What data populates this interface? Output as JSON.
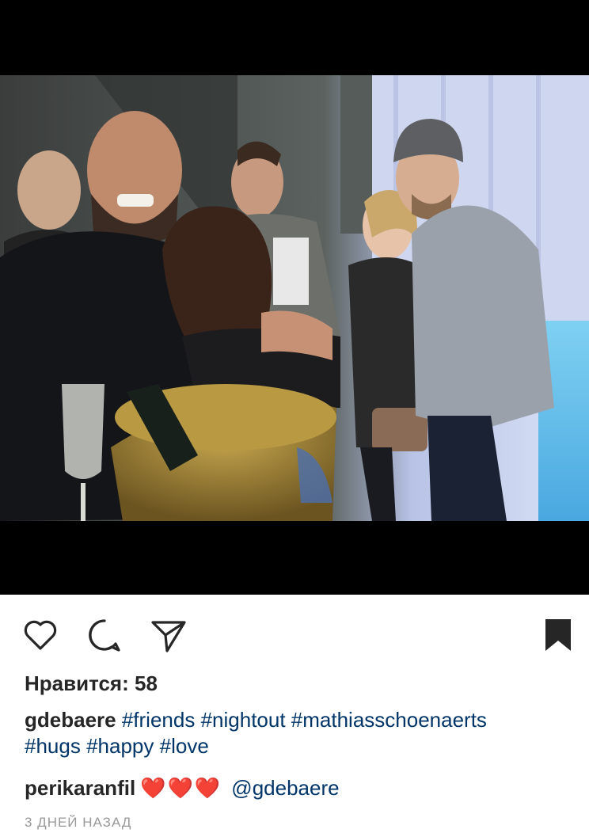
{
  "post": {
    "image_alt": "Group photo of friends at a party with a champagne bucket",
    "likes_label": "Нравится: 58",
    "caption": {
      "username": "gdebaere",
      "tags_line1": [
        "#friends",
        "#nightout",
        "#mathiasschoenaerts"
      ],
      "tags_line2": [
        "#hugs",
        "#happy",
        "#love"
      ]
    },
    "comment": {
      "username": "perikaranfil",
      "hearts": "❤️❤️❤️",
      "mention": "@gdebaere"
    },
    "timestamp": "3 ДНЕЙ НАЗАД"
  },
  "icons": {
    "like": "heart-icon",
    "comment": "comment-icon",
    "share": "send-icon",
    "save": "bookmark-icon"
  },
  "colors": {
    "text": "#262626",
    "hashtag": "#003569",
    "muted": "#999999",
    "heart": "#e0201e"
  }
}
